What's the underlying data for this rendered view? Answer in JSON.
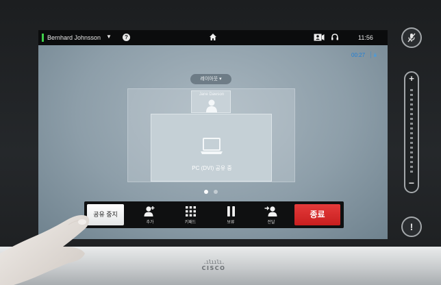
{
  "status_bar": {
    "user_name": "Bernhard Johnsson",
    "clock": "11:56"
  },
  "call": {
    "timer": "00:27"
  },
  "layout": {
    "button_label": "레이아웃",
    "participant_name": "Jane Dawson",
    "share_label": "PC (DVI) 공유 중",
    "pages": 2,
    "current_page": 1
  },
  "toolbar": {
    "stop_share_label": "공유 중지",
    "add_label": "추가",
    "keypad_label": "키패드",
    "hold_label": "보류",
    "transfer_label": "전달",
    "end_label": "종료"
  },
  "side": {
    "volume_plus": "+",
    "volume_minus": "−",
    "alert_symbol": "!"
  },
  "brand": {
    "bars": ".ılıılı.",
    "word": "CISCO"
  },
  "colors": {
    "end_call": "#d32a2a",
    "active_indicator": "#3fcf4a",
    "timer": "#1f7fd6"
  }
}
